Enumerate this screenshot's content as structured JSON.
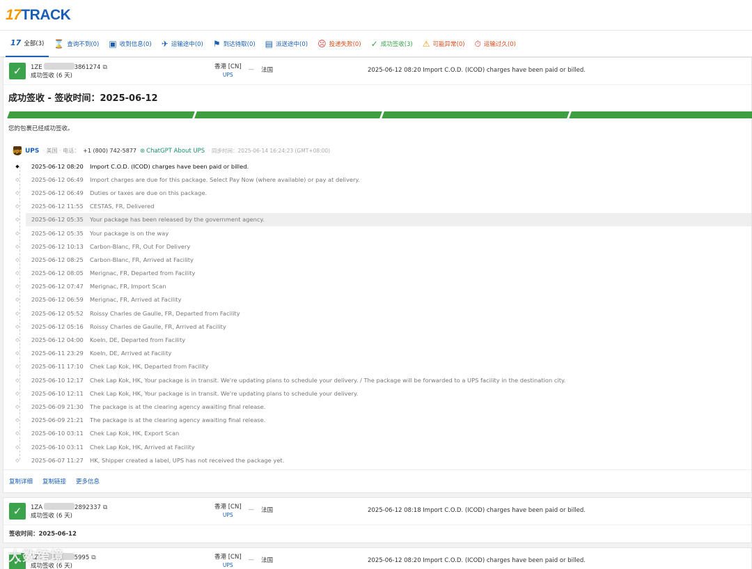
{
  "logo": {
    "num": "17",
    "word": "TRACK"
  },
  "tabs": [
    {
      "label": "全部(3)",
      "icon": "17-logo-icon",
      "glyph": "17"
    },
    {
      "label": "查询不到(0)",
      "icon": "hourglass-icon",
      "glyph": "⌛"
    },
    {
      "label": "收到信息(0)",
      "icon": "info-received-icon",
      "glyph": "▣"
    },
    {
      "label": "运输途中(0)",
      "icon": "airplane-icon",
      "glyph": "✈"
    },
    {
      "label": "到达待取(0)",
      "icon": "flag-icon",
      "glyph": "⚑"
    },
    {
      "label": "派送途中(0)",
      "icon": "delivery-truck-icon",
      "glyph": "▤"
    },
    {
      "label": "投递失败(0)",
      "icon": "sad-face-icon",
      "glyph": "☹"
    },
    {
      "label": "成功签收(3)",
      "icon": "checkmark-icon",
      "glyph": "✓"
    },
    {
      "label": "可能异常(0)",
      "icon": "warning-icon",
      "glyph": "⚠"
    },
    {
      "label": "运输过久(0)",
      "icon": "clock-alert-icon",
      "glyph": "⏱"
    }
  ],
  "shipments": [
    {
      "id_prefix": "1ZE",
      "id_suffix": "3861274",
      "status": "成功签收 (6 天)",
      "origin": "香港 [CN]",
      "carrier": "UPS",
      "destination": "法国",
      "latest": "2025-06-12 08:20  Import C.O.D. (ICOD) charges have been paid or billed."
    },
    {
      "id_prefix": "1ZA",
      "id_suffix": "2892337",
      "status": "成功签收 (6 天)",
      "origin": "香港 [CN]",
      "carrier": "UPS",
      "destination": "法国",
      "latest": "2025-06-12 08:18  Import C.O.D. (ICOD) charges have been paid or billed."
    },
    {
      "id_prefix": "1ZE",
      "id_suffix": "5995",
      "status": "成功签收 (6 天)",
      "origin": "香港 [CN]",
      "carrier": "UPS",
      "destination": "法国",
      "latest": "2025-06-12 08:20  Import C.O.D. (ICOD) charges have been paid or billed."
    }
  ],
  "detail": {
    "title": "成功签收 - 签收时间：2025-06-12",
    "message": "您的包裹已经成功签收。",
    "carrier_name": "UPS",
    "carrier_meta": "· 美国 · 电话：",
    "phone": "+1 (800) 742-5877",
    "gpt_link": "ChatGPT About UPS",
    "sync": "· 同步时间：2025-06-14 16:24:23 (GMT+08:00)",
    "events": [
      {
        "time": "2025-06-12 08:20",
        "desc": "Import C.O.D. (ICOD) charges have been paid or billed."
      },
      {
        "time": "2025-06-12 06:49",
        "desc": "Import charges are due for this package. Select Pay Now (where available) or pay at delivery."
      },
      {
        "time": "2025-06-12 06:49",
        "desc": "Duties or taxes are due on this package."
      },
      {
        "time": "2025-06-12 11:55",
        "desc": "CESTAS, FR, Delivered"
      },
      {
        "time": "2025-06-12 05:35",
        "desc": "Your package has been released by the government agency."
      },
      {
        "time": "2025-06-12 05:35",
        "desc": "Your package is on the way"
      },
      {
        "time": "2025-06-12 10:13",
        "desc": "Carbon-Blanc, FR, Out For Delivery"
      },
      {
        "time": "2025-06-12 08:25",
        "desc": "Carbon-Blanc, FR, Arrived at Facility"
      },
      {
        "time": "2025-06-12 08:05",
        "desc": "Merignac, FR, Departed from Facility"
      },
      {
        "time": "2025-06-12 07:47",
        "desc": "Merignac, FR, Import Scan"
      },
      {
        "time": "2025-06-12 06:59",
        "desc": "Merignac, FR, Arrived at Facility"
      },
      {
        "time": "2025-06-12 05:52",
        "desc": "Roissy Charles de Gaulle, FR, Departed from Facility"
      },
      {
        "time": "2025-06-12 05:16",
        "desc": "Roissy Charles de Gaulle, FR, Arrived at Facility"
      },
      {
        "time": "2025-06-12 04:00",
        "desc": "Koeln, DE, Departed from Facility"
      },
      {
        "time": "2025-06-11 23:29",
        "desc": "Koeln, DE, Arrived at Facility"
      },
      {
        "time": "2025-06-11 17:10",
        "desc": "Chek Lap Kok, HK, Departed from Facility"
      },
      {
        "time": "2025-06-10 12:17",
        "desc": "Chek Lap Kok, HK, Your package is in transit. We're updating plans to schedule your delivery. / The package will be forwarded to a UPS facility in the destination city."
      },
      {
        "time": "2025-06-10 12:11",
        "desc": "Chek Lap Kok, HK, Your package is in transit. We're updating plans to schedule your delivery."
      },
      {
        "time": "2025-06-09 21:30",
        "desc": "The package is at the clearing agency awaiting final release."
      },
      {
        "time": "2025-06-09 21:21",
        "desc": "The package is at the clearing agency awaiting final release."
      },
      {
        "time": "2025-06-10 03:11",
        "desc": "Chek Lap Kok, HK, Export Scan"
      },
      {
        "time": "2025-06-10 03:11",
        "desc": "Chek Lap Kok, HK, Arrived at Facility"
      },
      {
        "time": "2025-06-07 11:27",
        "desc": "HK, Shipper created a label, UPS has not received the package yet."
      }
    ],
    "actions": [
      "复制详细",
      "复制链接",
      "更多信息"
    ]
  },
  "second_receive_time": "签收时间：2025-06-12",
  "watermark": "大数跨境",
  "colors": {
    "accent": "#1a5fb4",
    "success": "#3aa34b",
    "logo_orange": "#f39800"
  }
}
